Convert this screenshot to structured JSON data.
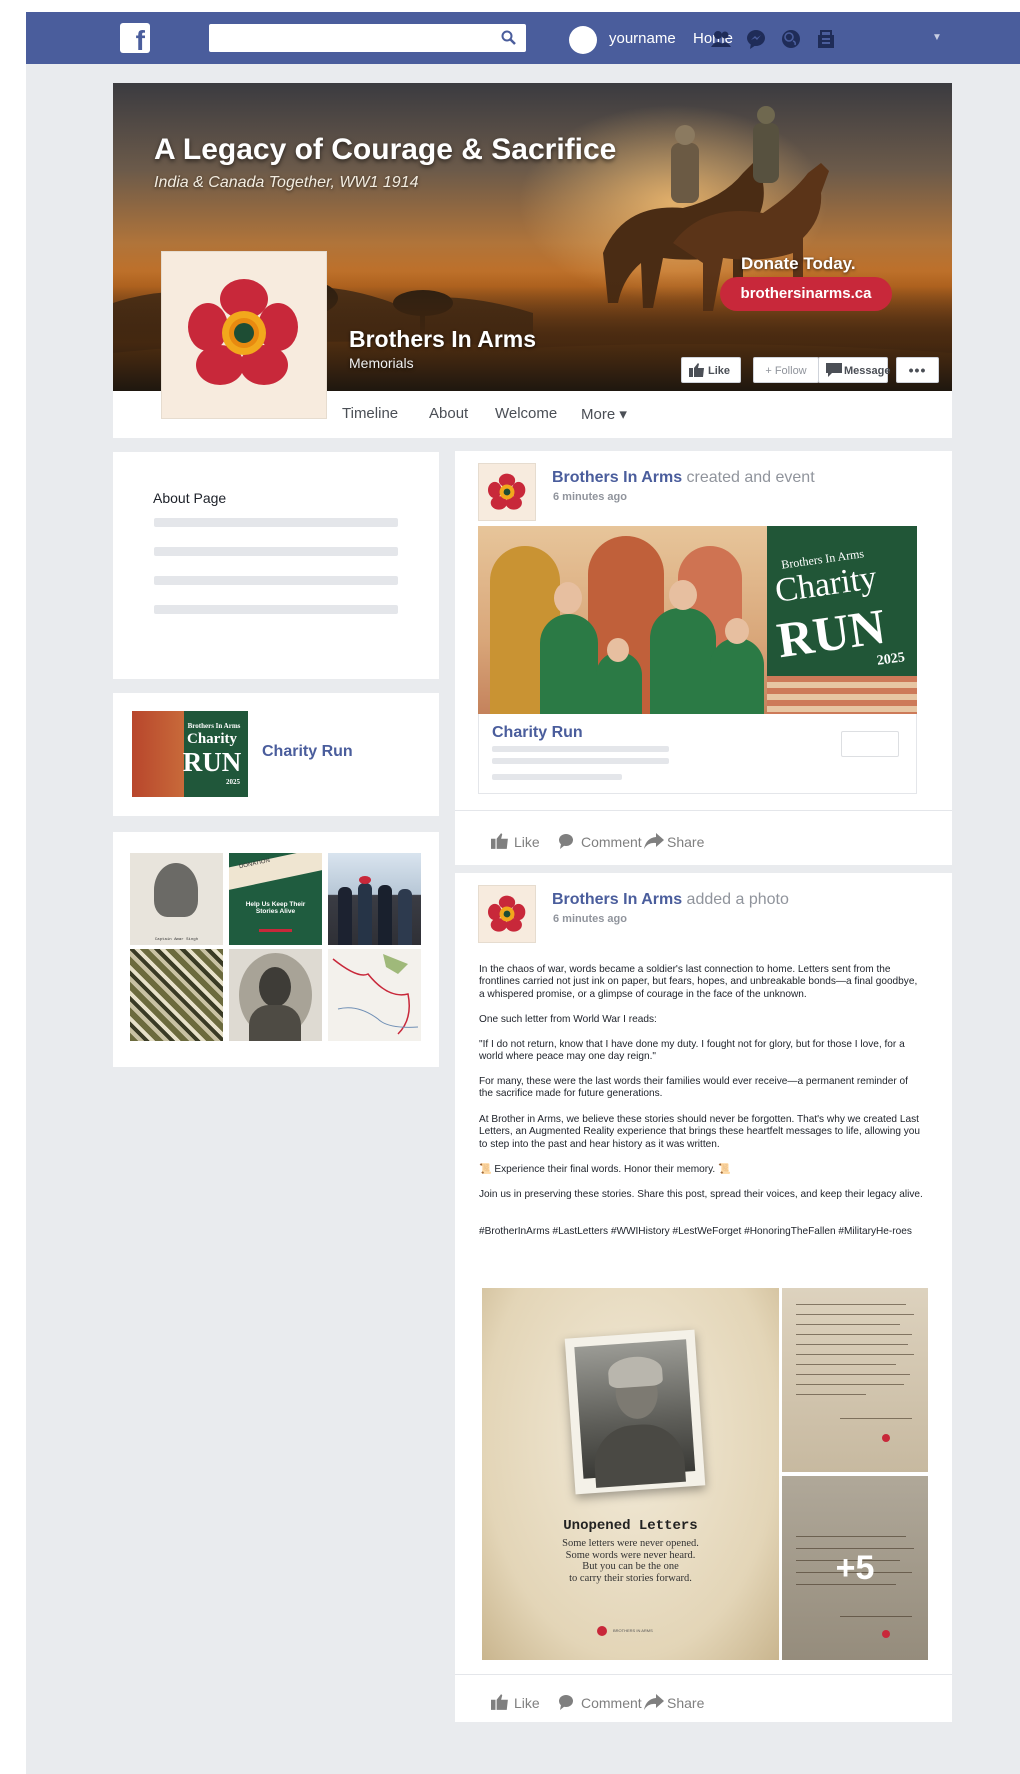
{
  "nav": {
    "username": "yourname",
    "home_label": "Home",
    "search_placeholder": "",
    "brand_color": "#4a5d9c",
    "icons": [
      "friends-icon",
      "messenger-icon",
      "globe-icon",
      "marketplace-icon"
    ]
  },
  "cover": {
    "headline": "A Legacy of Courage & Sacrifice",
    "subheadline": "India & Canada Together, WW1 1914",
    "donate_text": "Donate Today.",
    "donate_url": "brothersinarms.ca",
    "page_name": "Brothers In Arms",
    "page_category": "Memorials",
    "like_label": "Like",
    "follow_label": "+ Follow",
    "message_label": "Message",
    "more_label": "•••"
  },
  "tabs": [
    "Timeline",
    "About",
    "Welcome",
    "More ▾"
  ],
  "sidebar": {
    "about_title": "About Page",
    "event_thumb_brand": "Brothers In Arms",
    "event_thumb_title": "Charity",
    "event_thumb_run": "RUN",
    "event_thumb_year": "2025",
    "event_name": "Charity Run",
    "photos": [
      {
        "label": "portrait",
        "caption": "Captain Amar Singh"
      },
      {
        "label": "donation-poster",
        "top": "DONATION",
        "title": "Help Us Keep Their Stories Alive"
      },
      {
        "label": "group-photo"
      },
      {
        "label": "camouflage"
      },
      {
        "label": "soldier-portrait"
      },
      {
        "label": "map"
      }
    ]
  },
  "post1": {
    "author": "Brothers In Arms",
    "action": " created and event",
    "time": "6 minutes ago",
    "banner_brand": "Brothers In Arms",
    "banner_charity": "Charity",
    "banner_run": "RUN",
    "banner_year": "2025",
    "event_title": "Charity Run",
    "like": "Like",
    "comment": "Comment",
    "share": "Share"
  },
  "post2": {
    "author": "Brothers In Arms",
    "action": " added a photo",
    "time": "6 minutes ago",
    "paragraphs": [
      "In the chaos of war, words became a soldier's last connection to home. Letters sent from the frontlines carried not just ink on paper, but fears, hopes, and unbreakable bonds—a final goodbye, a whispered promise, or a glimpse of courage in the face of the unknown.",
      "One such letter from World War I reads:",
      "\"If I do not return, know that I have done my duty. I fought not for glory, but for those I love, for a world where peace may one day reign.\"",
      "For many, these were the last words their families would ever receive—a permanent reminder of the sacrifice made for future generations.",
      "At Brother in Arms, we believe these stories should never be forgotten. That's why we created Last Letters, an Augmented Reality experience that brings these heartfelt messages to life, allowing you to step into the past and hear history as it was written.",
      "📜 Experience their final words. Honor their memory. 📜",
      "Join us in preserving these stories. Share this post, spread their voices, and keep their legacy alive.",
      "#BrotherInArms #LastLetters #WWIHistory #LestWeForget #HonoringTheFallen #MilitaryHe-roes"
    ],
    "letters_title": "Unopened Letters",
    "letters_copy": "Some letters were never opened.\nSome words were never heard.\nBut you can be the one\nto carry their stories forward.",
    "letters_logo": "BROTHERS IN ARMS",
    "more_count": "+5",
    "like": "Like",
    "comment": "Comment",
    "share": "Share"
  }
}
